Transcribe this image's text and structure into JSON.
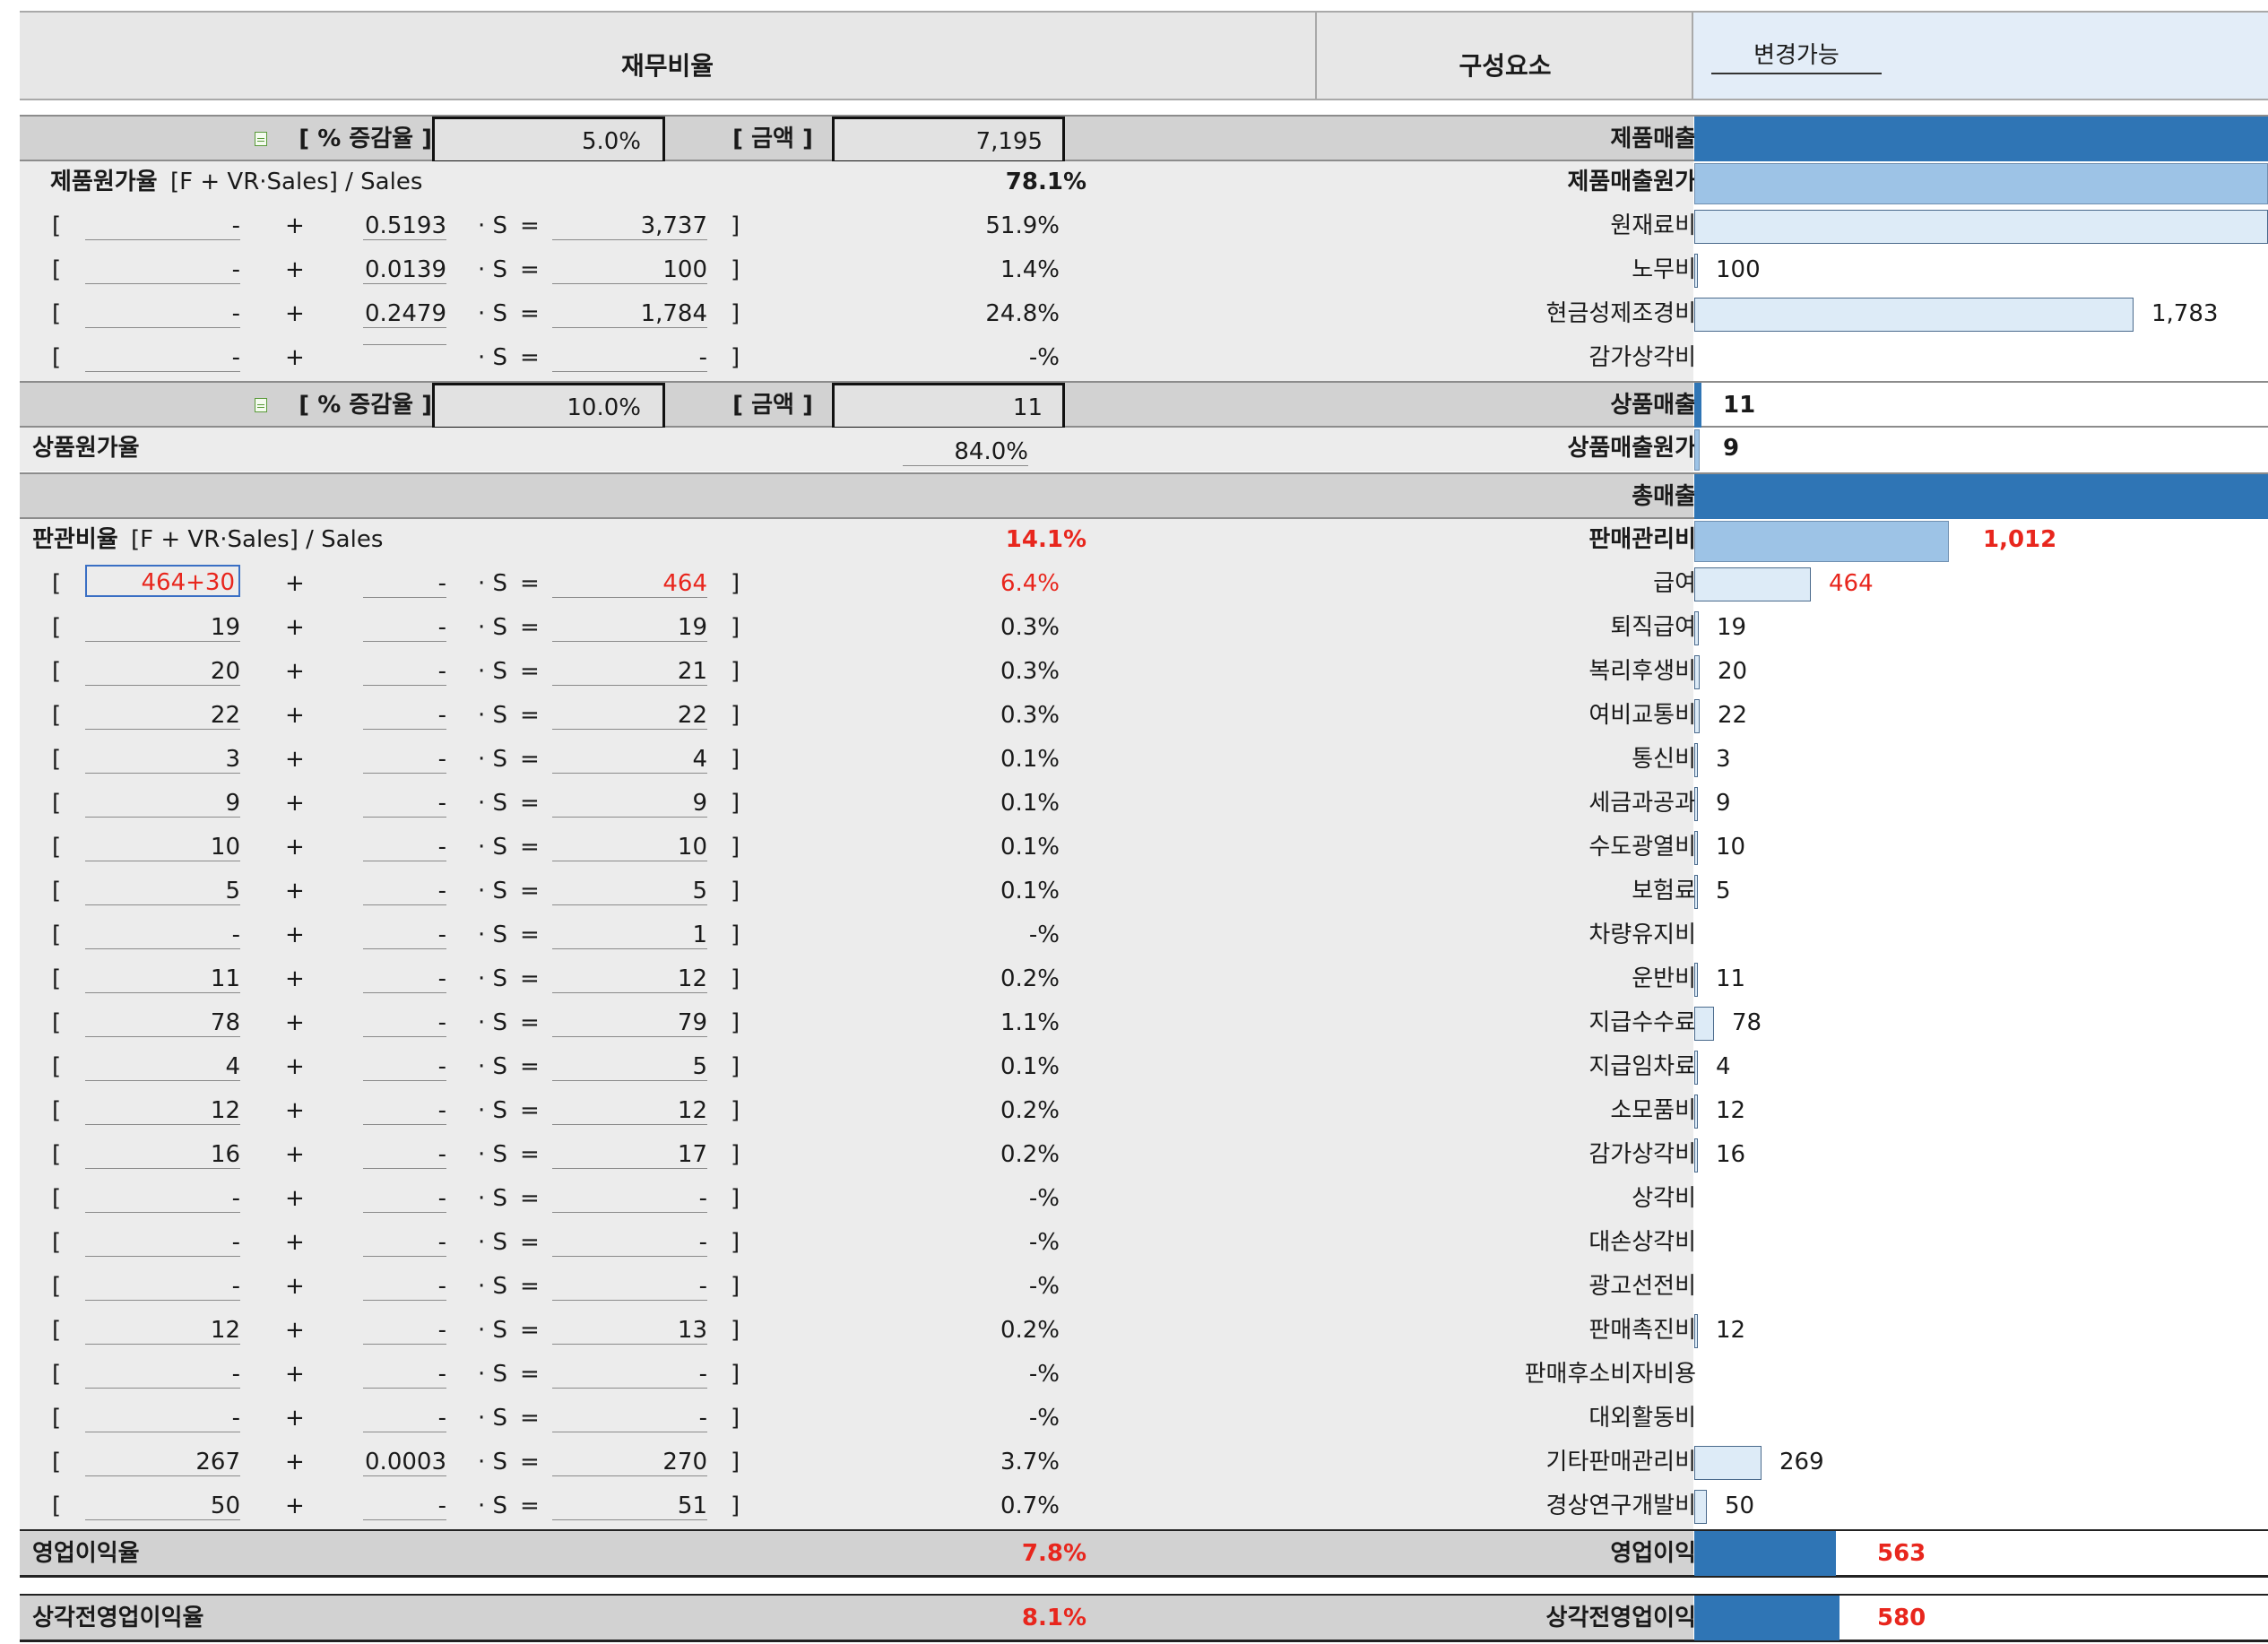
{
  "header": {
    "ratios_title": "재무비율",
    "components_title": "구성요소",
    "changeable_label": "변경가능"
  },
  "sales_block": {
    "pct_label": "[ % 증감율 ]",
    "pct_value": "5.0%",
    "amount_label": "[ 금액 ]",
    "amount_value": "7,195",
    "component": "제품매출"
  },
  "cogs": {
    "label": "제품원가율",
    "formula": "[F + VR·Sales] / Sales",
    "ratio": "78.1%",
    "component": "제품매출원가",
    "lines": [
      {
        "f": "-",
        "vr": "0.5193",
        "amt": "3,737",
        "pct": "51.9%",
        "name": "원재료비",
        "val": ""
      },
      {
        "f": "-",
        "vr": "0.0139",
        "amt": "100",
        "pct": "1.4%",
        "name": "노무비",
        "val": "100"
      },
      {
        "f": "-",
        "vr": "0.2479",
        "amt": "1,784",
        "pct": "24.8%",
        "name": "현금성제조경비",
        "val": "1,783"
      },
      {
        "f": "-",
        "vr": "",
        "amt": "-",
        "pct": "-%",
        "name": "감가상각비",
        "val": ""
      }
    ]
  },
  "merch_block": {
    "pct_label": "[ % 증감율 ]",
    "pct_value": "10.0%",
    "amount_label": "[ 금액 ]",
    "amount_value": "11",
    "component": "상품매출",
    "component_value": "11"
  },
  "merch_cogs": {
    "label": "상품원가율",
    "ratio": "84.0%",
    "component": "상품매출원가",
    "component_value": "9"
  },
  "total_sales": {
    "component": "총매출"
  },
  "sga": {
    "label": "판관비율",
    "formula": "[F + VR·Sales] / Sales",
    "ratio": "14.1%",
    "component": "판매관리비",
    "component_value": "1,012",
    "lines": [
      {
        "f": "464+30",
        "vr": "-",
        "amt": "464",
        "pct": "6.4%",
        "name": "급여",
        "val": "464",
        "red": true
      },
      {
        "f": "19",
        "vr": "-",
        "amt": "19",
        "pct": "0.3%",
        "name": "퇴직급여",
        "val": "19"
      },
      {
        "f": "20",
        "vr": "-",
        "amt": "21",
        "pct": "0.3%",
        "name": "복리후생비",
        "val": "20"
      },
      {
        "f": "22",
        "vr": "-",
        "amt": "22",
        "pct": "0.3%",
        "name": "여비교통비",
        "val": "22"
      },
      {
        "f": "3",
        "vr": "-",
        "amt": "4",
        "pct": "0.1%",
        "name": "통신비",
        "val": "3"
      },
      {
        "f": "9",
        "vr": "-",
        "amt": "9",
        "pct": "0.1%",
        "name": "세금과공과",
        "val": "9"
      },
      {
        "f": "10",
        "vr": "-",
        "amt": "10",
        "pct": "0.1%",
        "name": "수도광열비",
        "val": "10"
      },
      {
        "f": "5",
        "vr": "-",
        "amt": "5",
        "pct": "0.1%",
        "name": "보험료",
        "val": "5"
      },
      {
        "f": "-",
        "vr": "-",
        "amt": "1",
        "pct": "-%",
        "name": "차량유지비",
        "val": ""
      },
      {
        "f": "11",
        "vr": "-",
        "amt": "12",
        "pct": "0.2%",
        "name": "운반비",
        "val": "11"
      },
      {
        "f": "78",
        "vr": "-",
        "amt": "79",
        "pct": "1.1%",
        "name": "지급수수료",
        "val": "78"
      },
      {
        "f": "4",
        "vr": "-",
        "amt": "5",
        "pct": "0.1%",
        "name": "지급임차료",
        "val": "4"
      },
      {
        "f": "12",
        "vr": "-",
        "amt": "12",
        "pct": "0.2%",
        "name": "소모품비",
        "val": "12"
      },
      {
        "f": "16",
        "vr": "-",
        "amt": "17",
        "pct": "0.2%",
        "name": "감가상각비",
        "val": "16"
      },
      {
        "f": "-",
        "vr": "-",
        "amt": "-",
        "pct": "-%",
        "name": "상각비",
        "val": ""
      },
      {
        "f": "-",
        "vr": "-",
        "amt": "-",
        "pct": "-%",
        "name": "대손상각비",
        "val": ""
      },
      {
        "f": "-",
        "vr": "-",
        "amt": "-",
        "pct": "-%",
        "name": "광고선전비",
        "val": ""
      },
      {
        "f": "12",
        "vr": "-",
        "amt": "13",
        "pct": "0.2%",
        "name": "판매촉진비",
        "val": "12"
      },
      {
        "f": "-",
        "vr": "-",
        "amt": "-",
        "pct": "-%",
        "name": "판매후소비자비용",
        "val": ""
      },
      {
        "f": "-",
        "vr": "-",
        "amt": "-",
        "pct": "-%",
        "name": "대외활동비",
        "val": ""
      },
      {
        "f": "267",
        "vr": "0.0003",
        "amt": "270",
        "pct": "3.7%",
        "name": "기타판매관리비",
        "val": "269"
      },
      {
        "f": "50",
        "vr": "-",
        "amt": "51",
        "pct": "0.7%",
        "name": "경상연구개발비",
        "val": "50"
      }
    ]
  },
  "op_income": {
    "label": "영업이익율",
    "ratio": "7.8%",
    "component": "영업이익",
    "component_value": "563"
  },
  "ebitda": {
    "label": "상각전영업이익율",
    "ratio": "8.1%",
    "component": "상각전영업이익",
    "component_value": "580"
  },
  "symbols": {
    "open_bracket": "[",
    "plus": "+",
    "times_s": "· S",
    "equals": "=",
    "close_bracket": "]"
  },
  "colors": {
    "bar_dark": "#2f75b5",
    "bar_mid": "#9dc3e6",
    "bar_light": "#ddebf7",
    "negative_red": "#e8261d"
  }
}
